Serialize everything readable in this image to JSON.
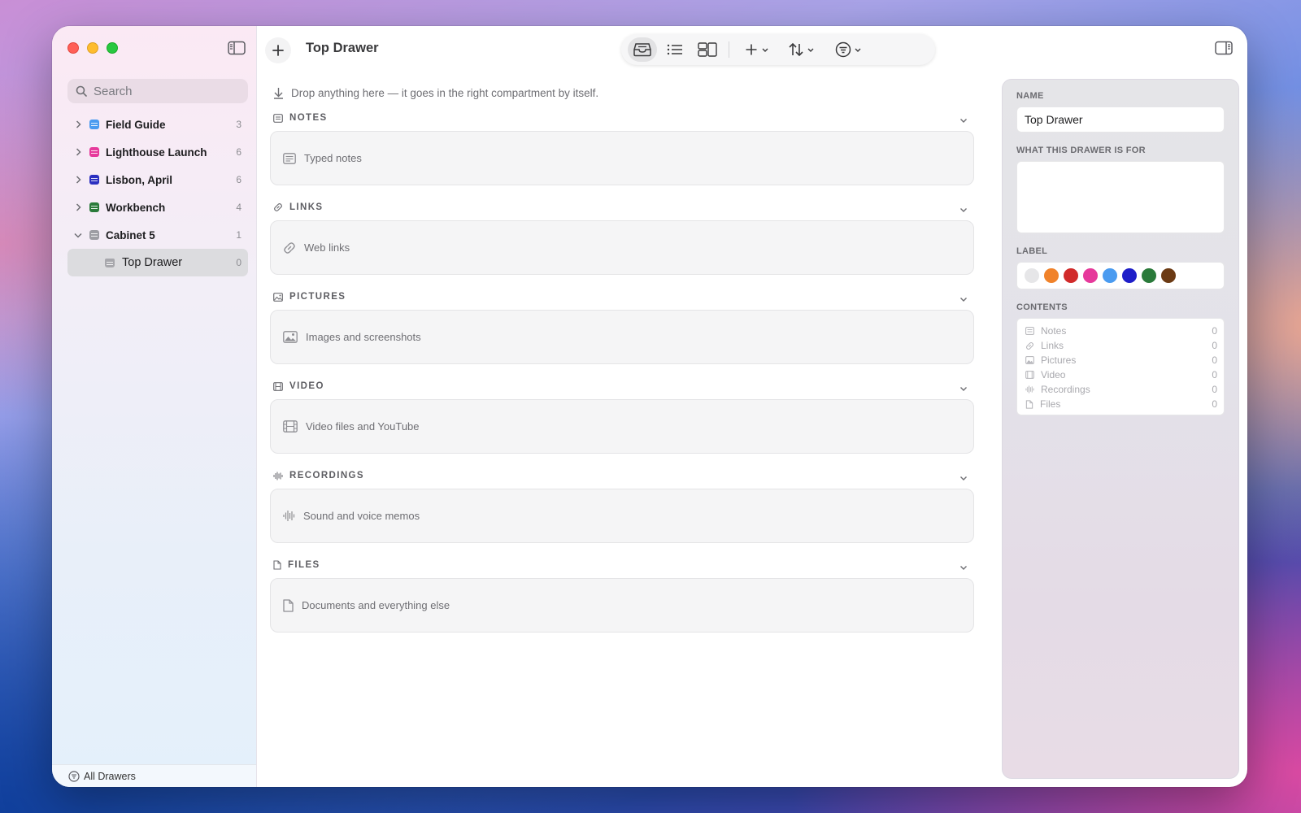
{
  "window": {
    "title": "Top Drawer"
  },
  "sidebar": {
    "search_placeholder": "Search",
    "items": [
      {
        "label": "Field Guide",
        "count": "3",
        "color": "#4a9bf0"
      },
      {
        "label": "Lighthouse Launch",
        "count": "6",
        "color": "#e6399b"
      },
      {
        "label": "Lisbon, April",
        "count": "6",
        "color": "#2b2fc0"
      },
      {
        "label": "Workbench",
        "count": "4",
        "color": "#2a7a3a"
      },
      {
        "label": "Cabinet 5",
        "count": "1",
        "color": "#9d9da3"
      }
    ],
    "child": {
      "label": "Top Drawer",
      "count": "0"
    },
    "footer_label": "All Drawers"
  },
  "main": {
    "drop_hint": "Drop anything here — it goes in the right compartment by itself.",
    "sections": [
      {
        "title": "NOTES",
        "placeholder": "Typed notes"
      },
      {
        "title": "LINKS",
        "placeholder": "Web links"
      },
      {
        "title": "PICTURES",
        "placeholder": "Images and screenshots"
      },
      {
        "title": "VIDEO",
        "placeholder": "Video files and YouTube"
      },
      {
        "title": "RECORDINGS",
        "placeholder": "Sound and voice memos"
      },
      {
        "title": "FILES",
        "placeholder": "Documents and everything else"
      }
    ]
  },
  "inspector": {
    "name_label": "NAME",
    "name_value": "Top Drawer",
    "purpose_label": "WHAT THIS DRAWER IS FOR",
    "purpose_value": "",
    "label_label": "LABEL",
    "label_colors": [
      "#e6e6e8",
      "#f0822a",
      "#d12a2a",
      "#e6399b",
      "#4a9bf0",
      "#1e1ec8",
      "#2a7a3a",
      "#6b3a14"
    ],
    "contents_label": "CONTENTS",
    "contents": [
      {
        "label": "Notes",
        "count": "0"
      },
      {
        "label": "Links",
        "count": "0"
      },
      {
        "label": "Pictures",
        "count": "0"
      },
      {
        "label": "Video",
        "count": "0"
      },
      {
        "label": "Recordings",
        "count": "0"
      },
      {
        "label": "Files",
        "count": "0"
      }
    ]
  }
}
